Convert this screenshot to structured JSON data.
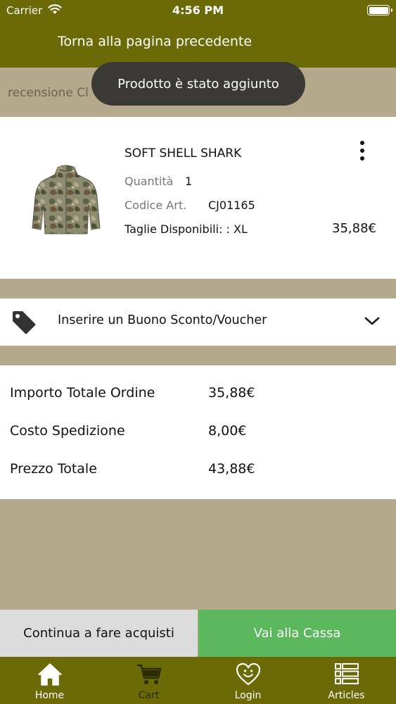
{
  "status_bar": {
    "carrier": "Carrier",
    "time": "4:56 PM"
  },
  "header": {
    "back_label": "Torna alla pagina precedente"
  },
  "review": {
    "text": "recensione Cl"
  },
  "toast": {
    "message": "Prodotto è stato aggiunto"
  },
  "product": {
    "name": "SOFT SHELL SHARK",
    "quantity_label": "Quantità",
    "quantity": "1",
    "code_label": "Codice Art.",
    "code": "CJ01165",
    "sizes_text": "Taglie Disponibili: : XL",
    "price": "35,88€"
  },
  "voucher": {
    "label": "Inserire un Buono Sconto/Voucher"
  },
  "totals": {
    "rows": [
      {
        "label": "Importo Totale Ordine",
        "value": "35,88€"
      },
      {
        "label": "Costo Spedizione",
        "value": "8,00€"
      },
      {
        "label": "Prezzo Totale",
        "value": "43,88€"
      }
    ]
  },
  "actions": {
    "continue_label": "Continua a fare acquisti",
    "checkout_label": "Vai alla Cassa"
  },
  "tabs": [
    {
      "label": "Home",
      "icon": "home-icon"
    },
    {
      "label": "Cart",
      "icon": "cart-icon"
    },
    {
      "label": "Login",
      "icon": "heart-face-icon"
    },
    {
      "label": "Articles",
      "icon": "list-icon"
    }
  ],
  "colors": {
    "header_bg": "#6b6a06",
    "page_bg": "#b4a98b",
    "checkout_green": "#5cb85c",
    "toast_bg": "#3a3935"
  }
}
